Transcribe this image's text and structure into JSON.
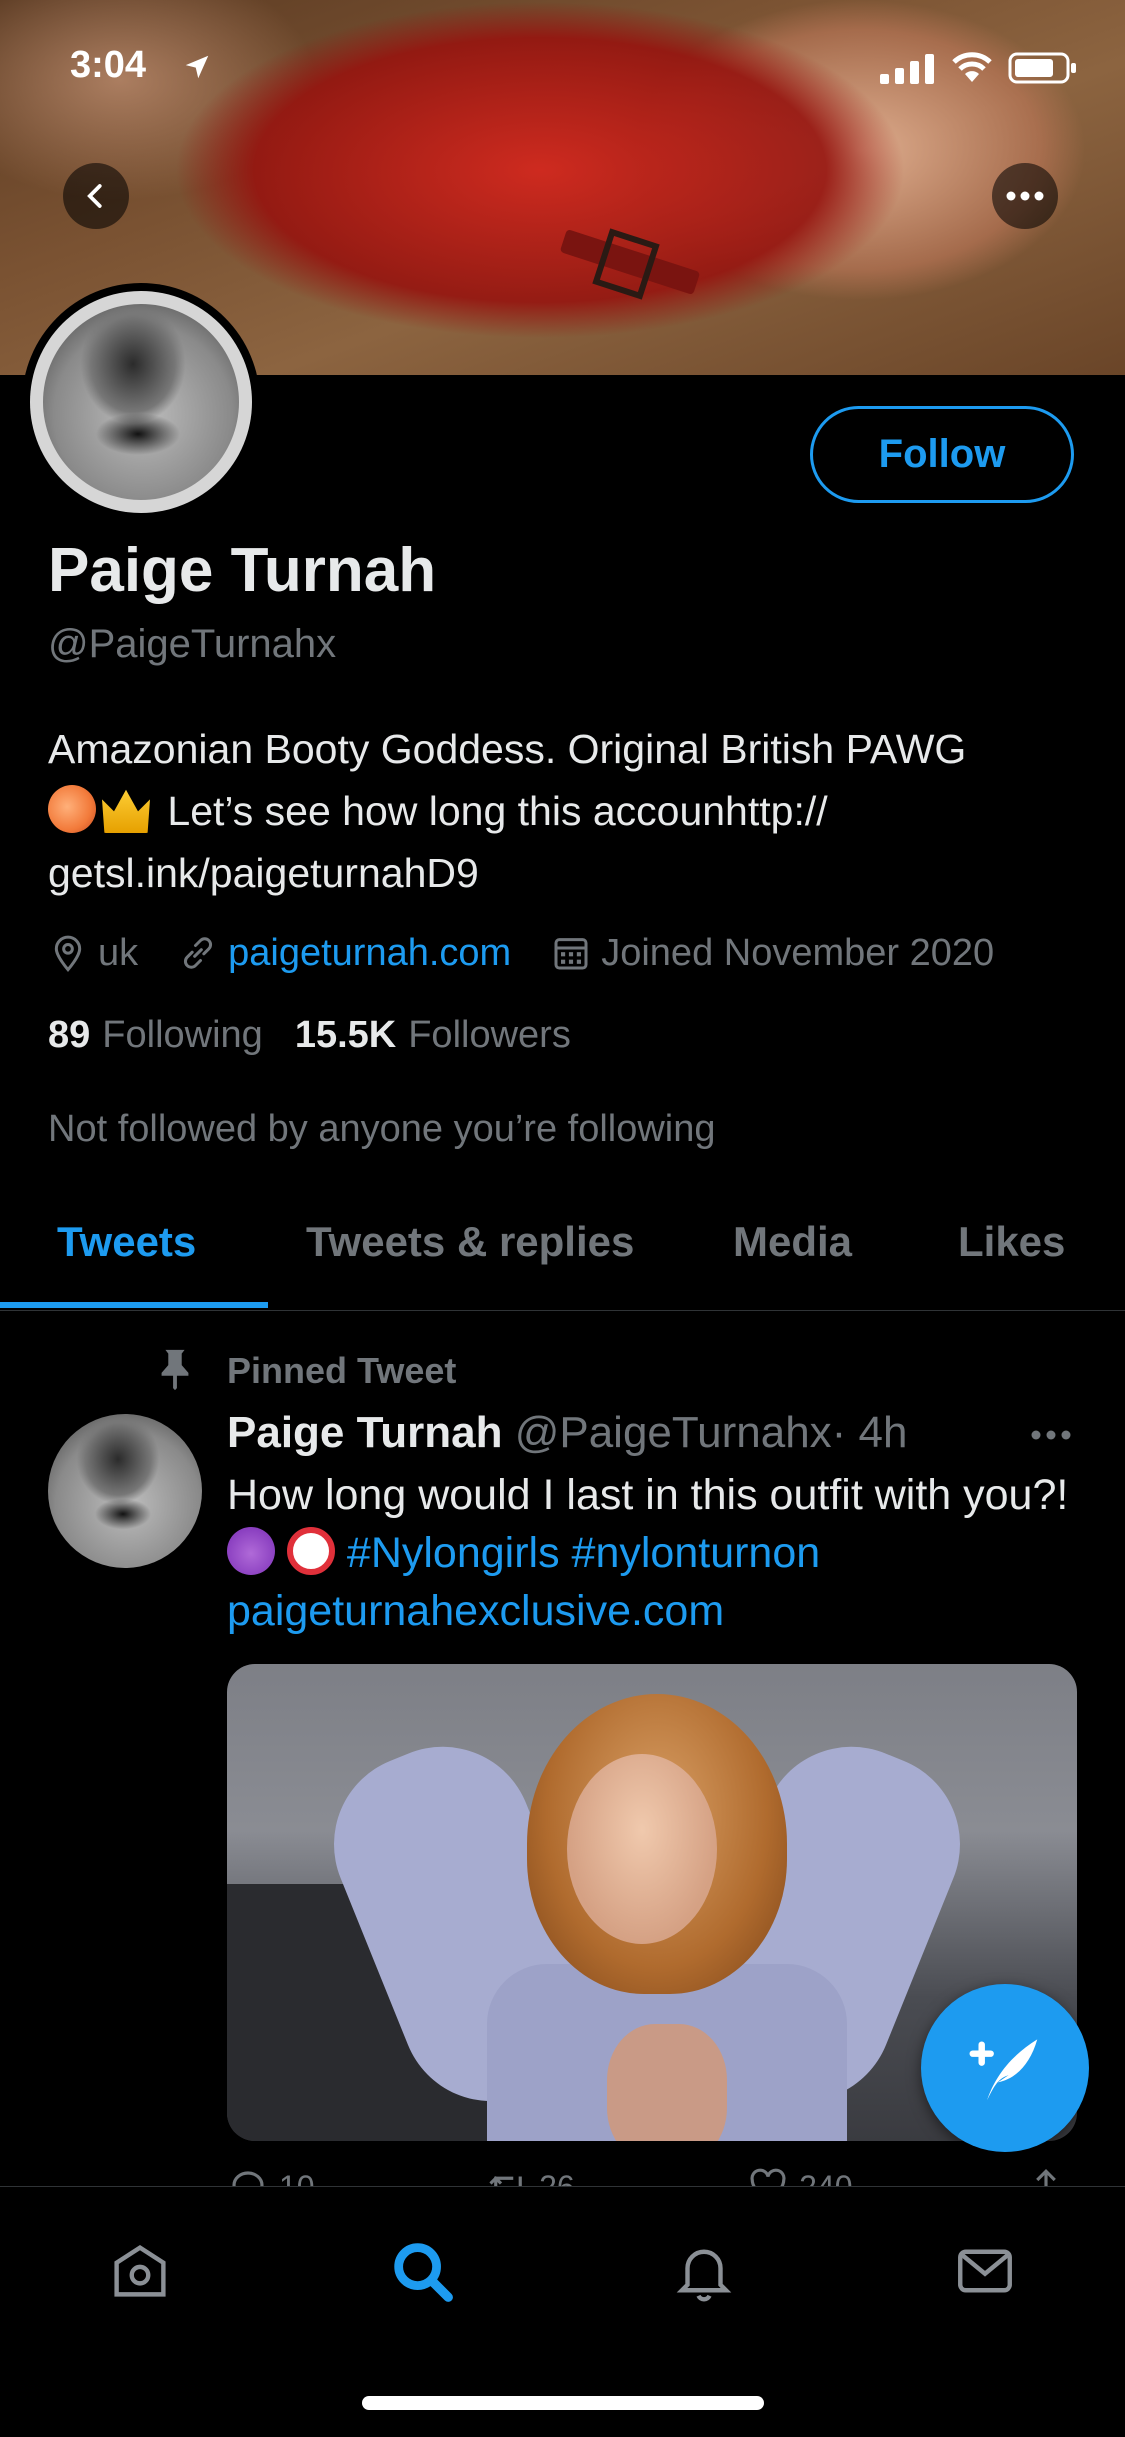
{
  "status_bar": {
    "time": "3:04"
  },
  "profile": {
    "follow_label": "Follow",
    "name": "Paige Turnah",
    "handle": "@PaigeTurnahx",
    "bio_line1": "Amazonian Booty Goddess. Original British PAWG",
    "bio_line2": " Let’s see how long this accounhttp://",
    "bio_line3": "getsl.ink/paigeturnahD9",
    "bio_emojis": [
      "peach",
      "crown"
    ],
    "location": "uk",
    "website": "paigeturnah.com",
    "joined": "Joined November 2020",
    "following_count": "89",
    "following_label": "Following",
    "followers_count": "15.5K",
    "followers_label": "Followers",
    "not_followed": "Not followed by anyone you’re following"
  },
  "tabs": [
    {
      "label": "Tweets",
      "active": true
    },
    {
      "label": "Tweets & replies",
      "active": false
    },
    {
      "label": "Media",
      "active": false
    },
    {
      "label": "Likes",
      "active": false
    }
  ],
  "pinned_tweet": {
    "pinned_label": "Pinned Tweet",
    "author_name": "Paige Turnah",
    "author_handle": "@PaigeTurnahx",
    "time": "· 4h",
    "text_start": "How long would I last in this outfit with you?! ",
    "emojis": [
      "smiling-imp",
      "no-one-under-18"
    ],
    "hashtags": " #Nylongirls #nylonturnon",
    "link": "paigeturnahexclusive.com",
    "counts": {
      "replies": "10",
      "retweets": "26",
      "likes": "240"
    }
  },
  "bottom_nav": [
    "home-icon",
    "search-icon",
    "notifications-icon",
    "messages-icon"
  ],
  "colors": {
    "accent": "#1d9bf0",
    "background": "#000000",
    "secondary_text": "#71767b"
  }
}
